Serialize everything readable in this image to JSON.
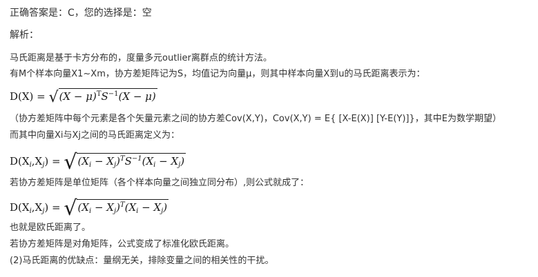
{
  "header": {
    "answer_line": "正确答案是：C，您的选择是：空",
    "analysis_label": "解析："
  },
  "content": {
    "p1": "马氏距离是基于卡方分布的，度量多元outlier离群点的统计方法。",
    "p2": "有M个样本向量X1~Xm，协方差矩阵记为S，均值记为向量μ，则其中样本向量X到u的马氏距离表示为：",
    "formula1": {
      "lhs": "D(X) =",
      "t1": "(X − μ)",
      "s1": "T",
      "t2": "S",
      "s2": "−1",
      "t3": "(X − μ)"
    },
    "p3": "（协方差矩阵中每个元素是各个矢量元素之间的协方差Cov(X,Y)，Cov(X,Y) = E{ [X-E(X)] [Y-E(Y)]}，其中E为数学期望）",
    "p4": "而其中向量Xi与Xj之间的马氏距离定义为：",
    "formula2": {
      "lhs_a": "D(X",
      "sub_i": "i",
      "lhs_b": ",X",
      "sub_j": "j",
      "lhs_c": ") =",
      "a": "(X",
      "b": " − X",
      "c": ")",
      "sup_t": "T",
      "d": "S",
      "sup_m1": "−1",
      "e": "(X",
      "f": " − X",
      "g": ")"
    },
    "p5": "若协方差矩阵是单位矩阵（各个样本向量之间独立同分布）,则公式就成了：",
    "formula3": {
      "lhs_a": "D(X",
      "sub_i": "i",
      "lhs_b": ",X",
      "sub_j": "j",
      "lhs_c": ") =",
      "a": "(X",
      "b": " − X",
      "c": ")",
      "sup_t": "T",
      "e": "(X",
      "f": " − X",
      "g": ")"
    },
    "p6": "也就是欧氏距离了。",
    "p7": "若协方差矩阵是对角矩阵，公式变成了标准化欧氏距离。",
    "p8": "(2)马氏距离的优缺点：量纲无关，排除变量之间的相关性的干扰。"
  }
}
